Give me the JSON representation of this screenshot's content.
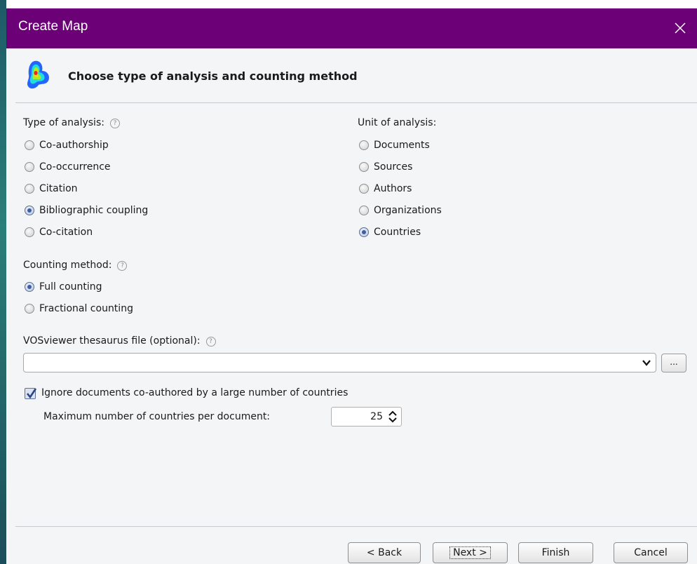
{
  "window": {
    "title": "Create Map"
  },
  "header": {
    "text": "Choose type of analysis and counting method"
  },
  "analysis": {
    "label": "Type of analysis:",
    "options": [
      "Co-authorship",
      "Co-occurrence",
      "Citation",
      "Bibliographic coupling",
      "Co-citation"
    ],
    "selected": "Bibliographic coupling"
  },
  "unit": {
    "label": "Unit of analysis:",
    "options": [
      "Documents",
      "Sources",
      "Authors",
      "Organizations",
      "Countries"
    ],
    "selected": "Countries"
  },
  "counting": {
    "label": "Counting method:",
    "options": [
      "Full counting",
      "Fractional counting"
    ],
    "selected": "Full counting"
  },
  "thesaurus": {
    "label": "VOSviewer thesaurus file (optional):",
    "value": "",
    "browse_label": "..."
  },
  "ignore": {
    "label": "Ignore documents co-authored by a large number of countries",
    "checked": true
  },
  "max_countries": {
    "label": "Maximum number of countries per document:",
    "value": "25"
  },
  "buttons": {
    "back": "< Back",
    "next": "Next >",
    "finish": "Finish",
    "cancel": "Cancel"
  },
  "help_glyph": "?",
  "colors": {
    "titlebar": "#6b0077",
    "background": "#f4f5f7",
    "radio_selected": "#3b5fa3"
  }
}
